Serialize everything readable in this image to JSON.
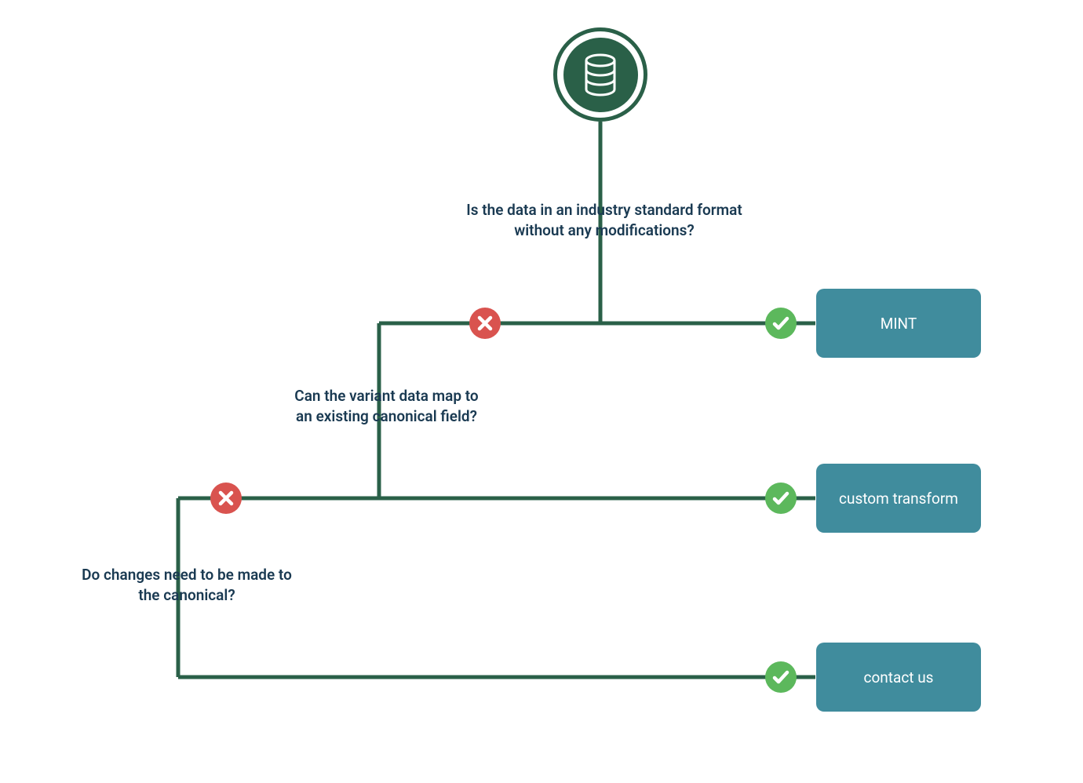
{
  "start": {
    "icon": "database"
  },
  "questions": {
    "q1": "Is the data in an industry standard format\nwithout any modifications?",
    "q2": "Can the variant data map to\nan existing canonical field?",
    "q3": "Do changes need to be made to\nthe canonical?"
  },
  "outcomes": {
    "o1": "MINT",
    "o2": "custom transform",
    "o3": "contact us"
  },
  "colors": {
    "line": "#2a6048",
    "text": "#1a3a52",
    "box": "#408c9d",
    "yes": "#5cb85c",
    "no": "#d9534f"
  }
}
